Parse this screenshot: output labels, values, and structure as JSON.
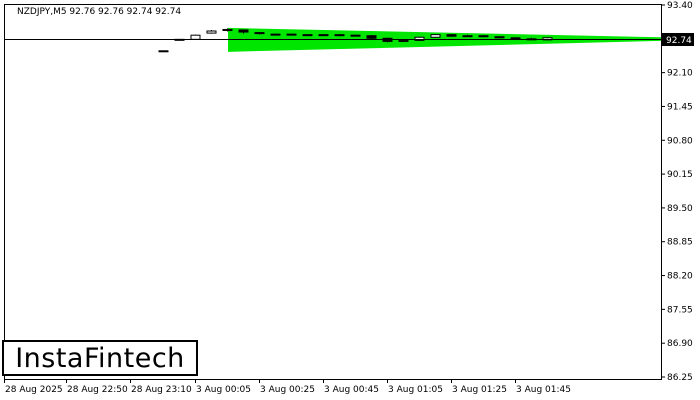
{
  "chart_data": {
    "type": "candlestick",
    "title": "NZDJPY,M5  92.76 92.76 92.74 92.74",
    "symbol": "NZDJPY,M5",
    "ohlc_readout": "92.76 92.76 92.74 92.74",
    "current_price": 92.74,
    "current_price_label": "92.74",
    "ylim": [
      86.25,
      93.4
    ],
    "y_ticks": [
      "93.40",
      "92.74",
      "92.10",
      "91.45",
      "90.80",
      "90.15",
      "89.50",
      "88.85",
      "88.20",
      "87.55",
      "86.90",
      "86.25"
    ],
    "x_ticks": [
      "28 Aug 2025",
      "28 Aug 22:50",
      "28 Aug 23:10",
      "3 Aug 00:05",
      "3 Aug 00:25",
      "3 Aug 00:45",
      "3 Aug 01:05",
      "3 Aug 01:25",
      "3 Aug 01:45"
    ],
    "candles": [
      {
        "o": 92.52,
        "h": 92.52,
        "l": 92.52,
        "c": 92.52
      },
      {
        "o": 92.73,
        "h": 92.74,
        "l": 92.72,
        "c": 92.74
      },
      {
        "o": 92.74,
        "h": 92.83,
        "l": 92.73,
        "c": 92.82
      },
      {
        "o": 92.86,
        "h": 92.92,
        "l": 92.85,
        "c": 92.9
      },
      {
        "o": 92.91,
        "h": 92.95,
        "l": 92.89,
        "c": 92.93
      },
      {
        "o": 92.92,
        "h": 92.93,
        "l": 92.85,
        "c": 92.88
      },
      {
        "o": 92.87,
        "h": 92.88,
        "l": 92.83,
        "c": 92.85
      },
      {
        "o": 92.84,
        "h": 92.85,
        "l": 92.83,
        "c": 92.84
      },
      {
        "o": 92.84,
        "h": 92.85,
        "l": 92.82,
        "c": 92.83
      },
      {
        "o": 92.83,
        "h": 92.84,
        "l": 92.82,
        "c": 92.83
      },
      {
        "o": 92.83,
        "h": 92.84,
        "l": 92.81,
        "c": 92.82
      },
      {
        "o": 92.82,
        "h": 92.84,
        "l": 92.8,
        "c": 92.83
      },
      {
        "o": 92.82,
        "h": 92.83,
        "l": 92.8,
        "c": 92.81
      },
      {
        "o": 92.81,
        "h": 92.82,
        "l": 92.74,
        "c": 92.76
      },
      {
        "o": 92.76,
        "h": 92.77,
        "l": 92.68,
        "c": 92.7
      },
      {
        "o": 92.7,
        "h": 92.73,
        "l": 92.69,
        "c": 92.72
      },
      {
        "o": 92.72,
        "h": 92.79,
        "l": 92.71,
        "c": 92.78
      },
      {
        "o": 92.78,
        "h": 92.84,
        "l": 92.77,
        "c": 92.83
      },
      {
        "o": 92.83,
        "h": 92.84,
        "l": 92.79,
        "c": 92.8
      },
      {
        "o": 92.8,
        "h": 92.83,
        "l": 92.79,
        "c": 92.81
      },
      {
        "o": 92.81,
        "h": 92.82,
        "l": 92.78,
        "c": 92.79
      },
      {
        "o": 92.79,
        "h": 92.8,
        "l": 92.76,
        "c": 92.77
      },
      {
        "o": 92.77,
        "h": 92.78,
        "l": 92.75,
        "c": 92.76
      },
      {
        "o": 92.75,
        "h": 92.77,
        "l": 92.73,
        "c": 92.74
      },
      {
        "o": 92.73,
        "h": 92.78,
        "l": 92.72,
        "c": 92.77
      }
    ],
    "pattern_band": {
      "color": "#00e600",
      "upper": [
        92.96,
        92.78
      ],
      "lower": [
        92.5,
        92.71
      ]
    },
    "colors": {
      "bull_body": "#ffffff",
      "bear_body": "#000000",
      "price_line": "#000000",
      "price_label_bg": "#000000",
      "price_label_text": "#ffffff"
    }
  },
  "logo_text": "InstaFintech"
}
